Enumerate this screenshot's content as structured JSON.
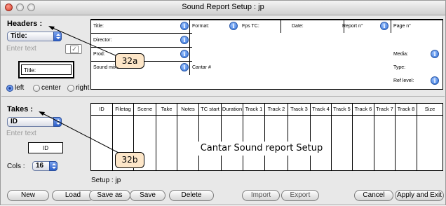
{
  "window": {
    "title": "Sound Report Setup : jp"
  },
  "headers": {
    "label": "Headers :",
    "popup_value": "Title:",
    "text_placeholder": "Enter text",
    "preview_value": "Title:",
    "align_options": [
      "left",
      "center",
      "right"
    ],
    "align_selected": "left"
  },
  "header_grid": {
    "row1": {
      "c1": "Title:",
      "c2": "Format:",
      "c3": "Fps TC:",
      "c4": "Date:",
      "c5": "Report n°",
      "c6": "Page n°"
    },
    "row2": {
      "c1": "Director:"
    },
    "row3": {
      "c1": "Prod:",
      "c6": "Media:"
    },
    "row4": {
      "c1": "Sound mixer:",
      "c2": "Cantar #",
      "c6": "Type:"
    },
    "row5": {
      "c6": "Ref level:"
    }
  },
  "takes": {
    "label": "Takes :",
    "popup_value": "ID",
    "text_placeholder": "Enter text",
    "preview_value": "ID",
    "cols_label": "Cols :",
    "cols_value": "16"
  },
  "takes_table": {
    "columns": [
      "ID",
      "Filetag",
      "Scene",
      "Take",
      "Notes",
      "TC start",
      "Duration",
      "Track 1",
      "Track 2",
      "Track 3",
      "Track 4",
      "Track 5",
      "Track 6",
      "Track 7",
      "Track 8",
      "Size"
    ],
    "watermark": "Cantar Sound report Setup"
  },
  "setup_label": "Setup : jp",
  "callouts": {
    "a": "32a",
    "b": "32b"
  },
  "buttons": {
    "new": "New",
    "load": "Load",
    "save_as": "Save as",
    "save": "Save",
    "delete": "Delete",
    "import": "Import",
    "export": "Export",
    "cancel": "Cancel",
    "apply_exit": "Apply and Exit"
  },
  "icons": {
    "info": "i"
  },
  "colors": {
    "accent": "#2f6fd8",
    "callout_fill": "#fde6c8",
    "close_light": "#d23a28"
  }
}
